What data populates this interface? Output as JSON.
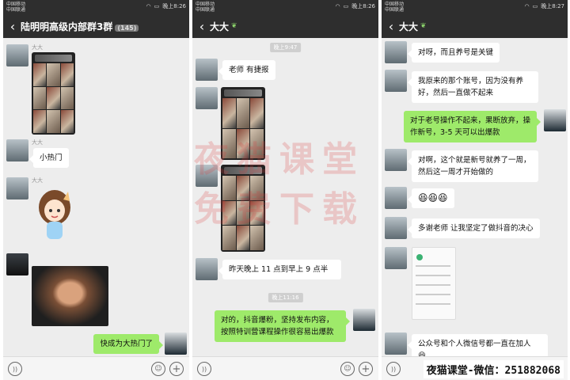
{
  "panels": [
    {
      "status": {
        "carrier1": "中国移动",
        "carrier2": "中国联通",
        "time": "晚上8:26"
      },
      "title": "陆明明高级内部群3群",
      "title_badge": "(145)",
      "sender_name": "大大",
      "messages": [
        {
          "text": "小热门"
        },
        {
          "text": "快成为大热门了"
        }
      ]
    },
    {
      "status": {
        "carrier1": "中国移动",
        "carrier2": "中国联通",
        "time": "晚上8:26"
      },
      "title": "大大",
      "time_chip_1": "晚上9:47",
      "time_chip_2": "晚上11:16",
      "messages": [
        {
          "text": "老师 有捷报"
        },
        {
          "text": "昨天晚上 11 点到早上 9 点半"
        },
        {
          "text": "对的，抖音爆粉，坚持发布内容，按照特训营课程操作很容易出爆款"
        }
      ]
    },
    {
      "status": {
        "carrier1": "中国移动",
        "carrier2": "中国联通",
        "time": "晚上8:27"
      },
      "title": "大大",
      "messages": [
        {
          "text": "对呀，而且养号是关键"
        },
        {
          "text": "我原来的那个账号，因为没有养好，然后一直做不起来"
        },
        {
          "text": "对于老号操作不起来，果断放弃，操作新号，3-5 天可以出爆款"
        },
        {
          "text": "对啊，这个就是新号就养了一周，然后这一周才开始做的"
        },
        {
          "text": "😆😆😆"
        },
        {
          "text": "多谢老师 让我坚定了做抖音的决心"
        },
        {
          "text": "公众号和个人微信号都一直在加人"
        },
        {
          "text": "😆"
        }
      ]
    }
  ],
  "watermark": {
    "line1": "夜猫课堂",
    "line2": "免费下载"
  },
  "footer": "夜猫课堂-微信：251882068",
  "colors": {
    "bubble_out": "#9eea6a",
    "bubble_in": "#ffffff",
    "titlebar": "#2e2e2e",
    "chat_bg": "#ededed"
  },
  "icons": {
    "back": "back-arrow-icon",
    "voice": "voice-icon",
    "emoji": "emoji-icon",
    "plus": "plus-icon"
  }
}
